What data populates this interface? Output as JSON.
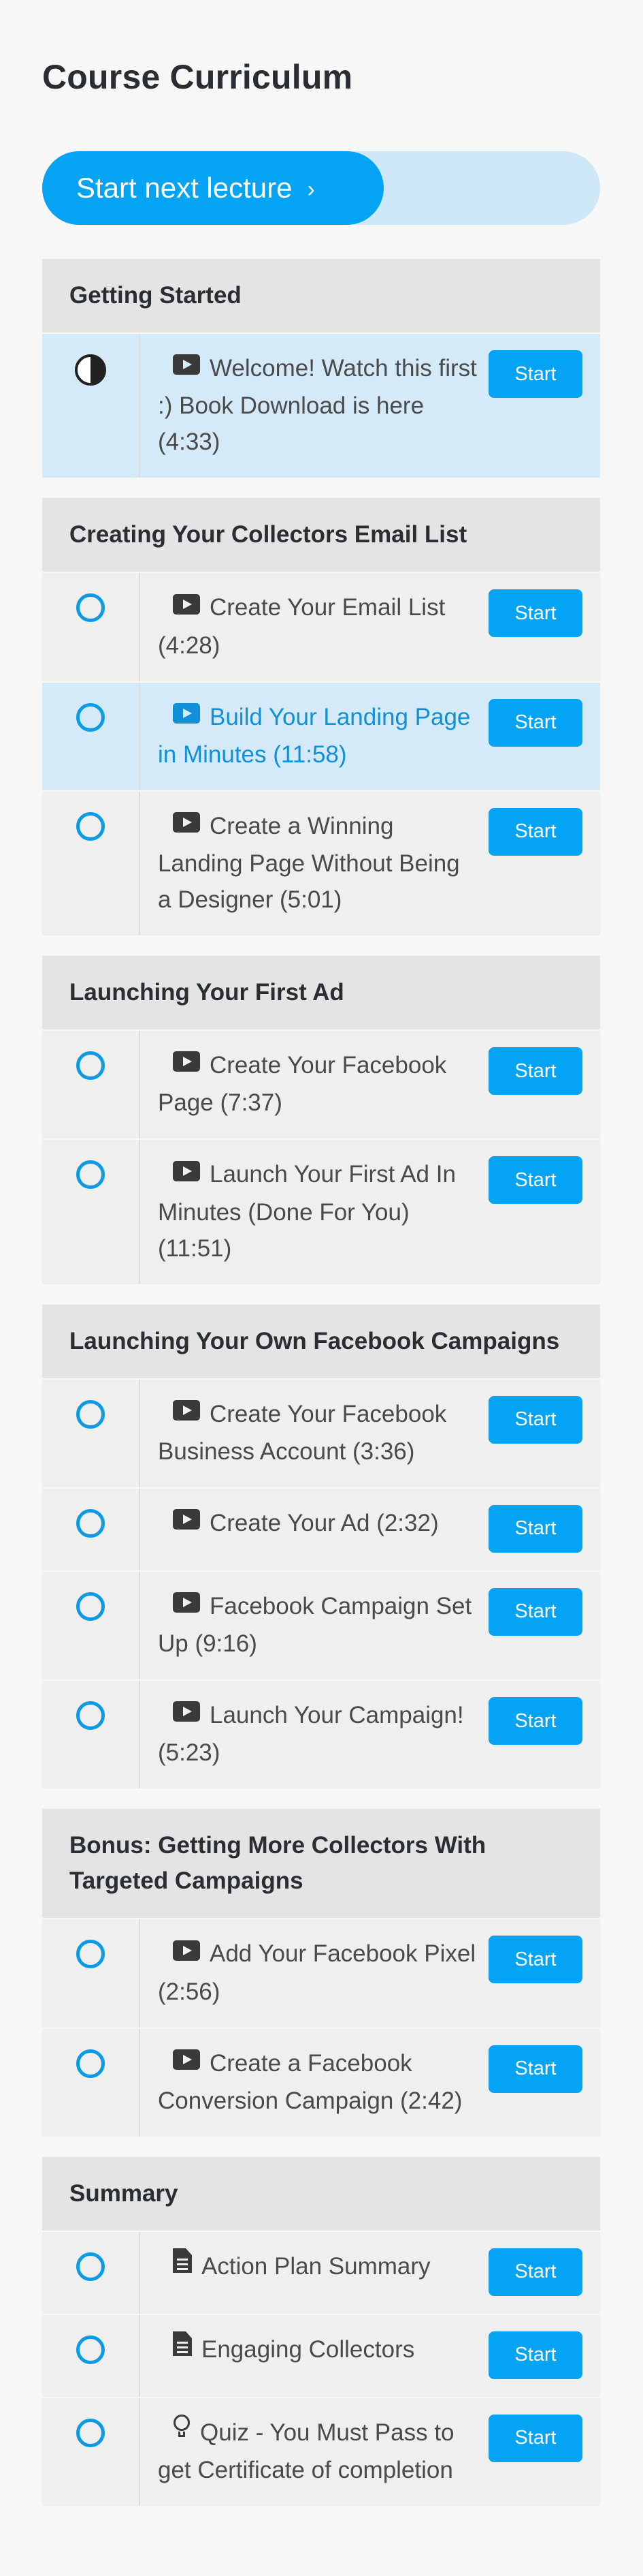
{
  "page_title": "Course Curriculum",
  "progress": {
    "button_label": "Start next lecture",
    "chevron": "›"
  },
  "start_label": "Start",
  "sections": [
    {
      "title": "Getting Started",
      "items": [
        {
          "label": "Welcome! Watch this first :) Book Download is here (4:33)",
          "icon": "play-icon",
          "status": "in-progress",
          "highlight": "active"
        }
      ]
    },
    {
      "title": "Creating Your Collectors Email List",
      "items": [
        {
          "label": "Create Your Email List (4:28)",
          "icon": "play-icon",
          "status": "incomplete",
          "highlight": ""
        },
        {
          "label": "Build Your Landing Page in Minutes (11:58)",
          "icon": "play-icon",
          "status": "incomplete",
          "highlight": "current"
        },
        {
          "label": "Create a Winning Landing Page Without Being a Designer (5:01)",
          "icon": "play-icon",
          "status": "incomplete",
          "highlight": ""
        }
      ]
    },
    {
      "title": "Launching Your First Ad",
      "items": [
        {
          "label": "Create Your Facebook Page (7:37)",
          "icon": "play-icon",
          "status": "incomplete",
          "highlight": ""
        },
        {
          "label": "Launch Your First Ad In Minutes (Done For You) (11:51)",
          "icon": "play-icon",
          "status": "incomplete",
          "highlight": ""
        }
      ]
    },
    {
      "title": "Launching Your Own Facebook Campaigns",
      "items": [
        {
          "label": "Create Your Facebook Business Account (3:36)",
          "icon": "play-icon",
          "status": "incomplete",
          "highlight": ""
        },
        {
          "label": "Create Your Ad (2:32)",
          "icon": "play-icon",
          "status": "incomplete",
          "highlight": ""
        },
        {
          "label": "Facebook Campaign Set Up (9:16)",
          "icon": "play-icon",
          "status": "incomplete",
          "highlight": ""
        },
        {
          "label": "Launch Your Campaign! (5:23)",
          "icon": "play-icon",
          "status": "incomplete",
          "highlight": ""
        }
      ]
    },
    {
      "title": "Bonus: Getting More Collectors With Targeted Campaigns",
      "items": [
        {
          "label": "Add Your Facebook Pixel (2:56)",
          "icon": "play-icon",
          "status": "incomplete",
          "highlight": ""
        },
        {
          "label": "Create a Facebook Conversion Campaign (2:42)",
          "icon": "play-icon",
          "status": "incomplete",
          "highlight": ""
        }
      ]
    },
    {
      "title": "Summary",
      "items": [
        {
          "label": "Action Plan Summary",
          "icon": "document-icon",
          "status": "incomplete",
          "highlight": ""
        },
        {
          "label": "Engaging Collectors",
          "icon": "document-icon",
          "status": "incomplete",
          "highlight": ""
        },
        {
          "label": "Quiz - You Must Pass to get Certificate of completion",
          "icon": "lightbulb-icon",
          "status": "incomplete",
          "highlight": ""
        }
      ]
    }
  ],
  "colors": {
    "accent": "#05a3f4",
    "accent_light": "#cfe8f7",
    "current_text": "#1190d8",
    "section_bg": "#e4e4e4",
    "item_bg": "#efefef"
  }
}
